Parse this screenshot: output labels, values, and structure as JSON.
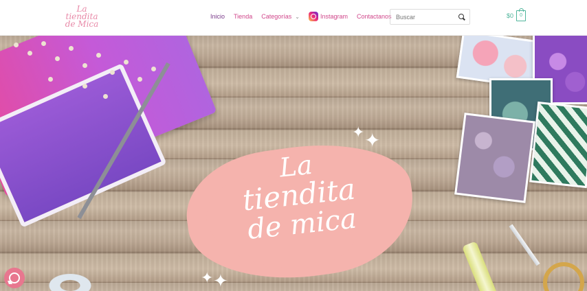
{
  "header": {
    "logo": {
      "line1": "La",
      "line2": "tiendita",
      "line3": "de Mica"
    },
    "nav": [
      {
        "label": "Inicio"
      },
      {
        "label": "Tienda"
      },
      {
        "label": "Categorías"
      },
      {
        "label": "Instagram"
      },
      {
        "label": "Contactanos"
      }
    ],
    "search": {
      "placeholder": "Buscar"
    },
    "cart": {
      "total": "$0",
      "count": "0"
    }
  },
  "hero": {
    "title": {
      "line1": "La",
      "line2": "tiendita",
      "line3": "de mica"
    }
  },
  "colors": {
    "accent": "#d0468a",
    "active": "#7a3a8a",
    "cart": "#4fb59b",
    "splash": "#f5b3ad"
  },
  "icons": [
    "chevron-down-icon",
    "instagram-icon",
    "search-icon",
    "cart-icon",
    "whatsapp-icon",
    "sparkle-icon"
  ]
}
